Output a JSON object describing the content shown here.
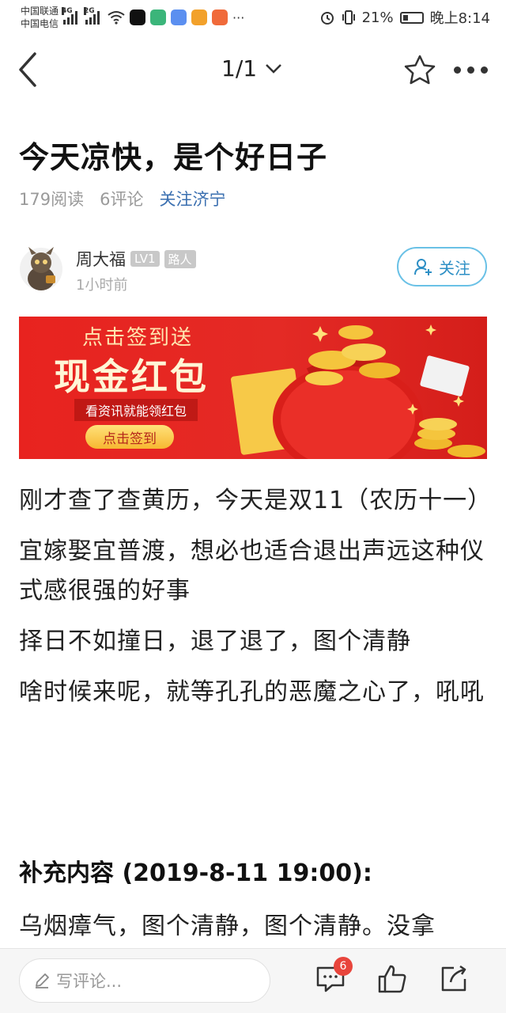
{
  "status_bar": {
    "carrier1": "中国联通",
    "carrier2": "中国电信",
    "sig1_label": "4G",
    "sig2_label": "2G",
    "battery_pct": "21%",
    "time": "晚上8:14"
  },
  "nav": {
    "pager": "1/1"
  },
  "article": {
    "title": "今天凉快，是个好日子",
    "reads": "179阅读",
    "comments": "6评论",
    "follow_topic": "关注济宁"
  },
  "author": {
    "name": "周大福",
    "level": "LV1",
    "role": "路人",
    "time": "1小时前",
    "follow_label": "关注"
  },
  "banner": {
    "line1": "点击签到送",
    "line2": "现金红包",
    "line3": "看资讯就能领红包",
    "button": "点击签到"
  },
  "content": {
    "paragraphs": [
      "刚才查了查黄历，今天是双11（农历十一）",
      "宜嫁娶宜普渡，想必也适合退出声远这种仪式感很强的好事",
      "择日不如撞日，退了退了，图个清静",
      "啥时候来呢，就等孔孔的恶魔之心了，吼吼"
    ],
    "supplement_heading": "补充内容 (2019-8-11 19:00):",
    "supplement_text": "乌烟瘴气，图个清静，图个清静。没拿"
  },
  "bottom_bar": {
    "comment_placeholder": "写评论...",
    "comment_count": "6"
  },
  "colors": {
    "accent_blue": "#2d8fc5",
    "badge_red": "#e8453c",
    "banner_red": "#e42a25"
  }
}
